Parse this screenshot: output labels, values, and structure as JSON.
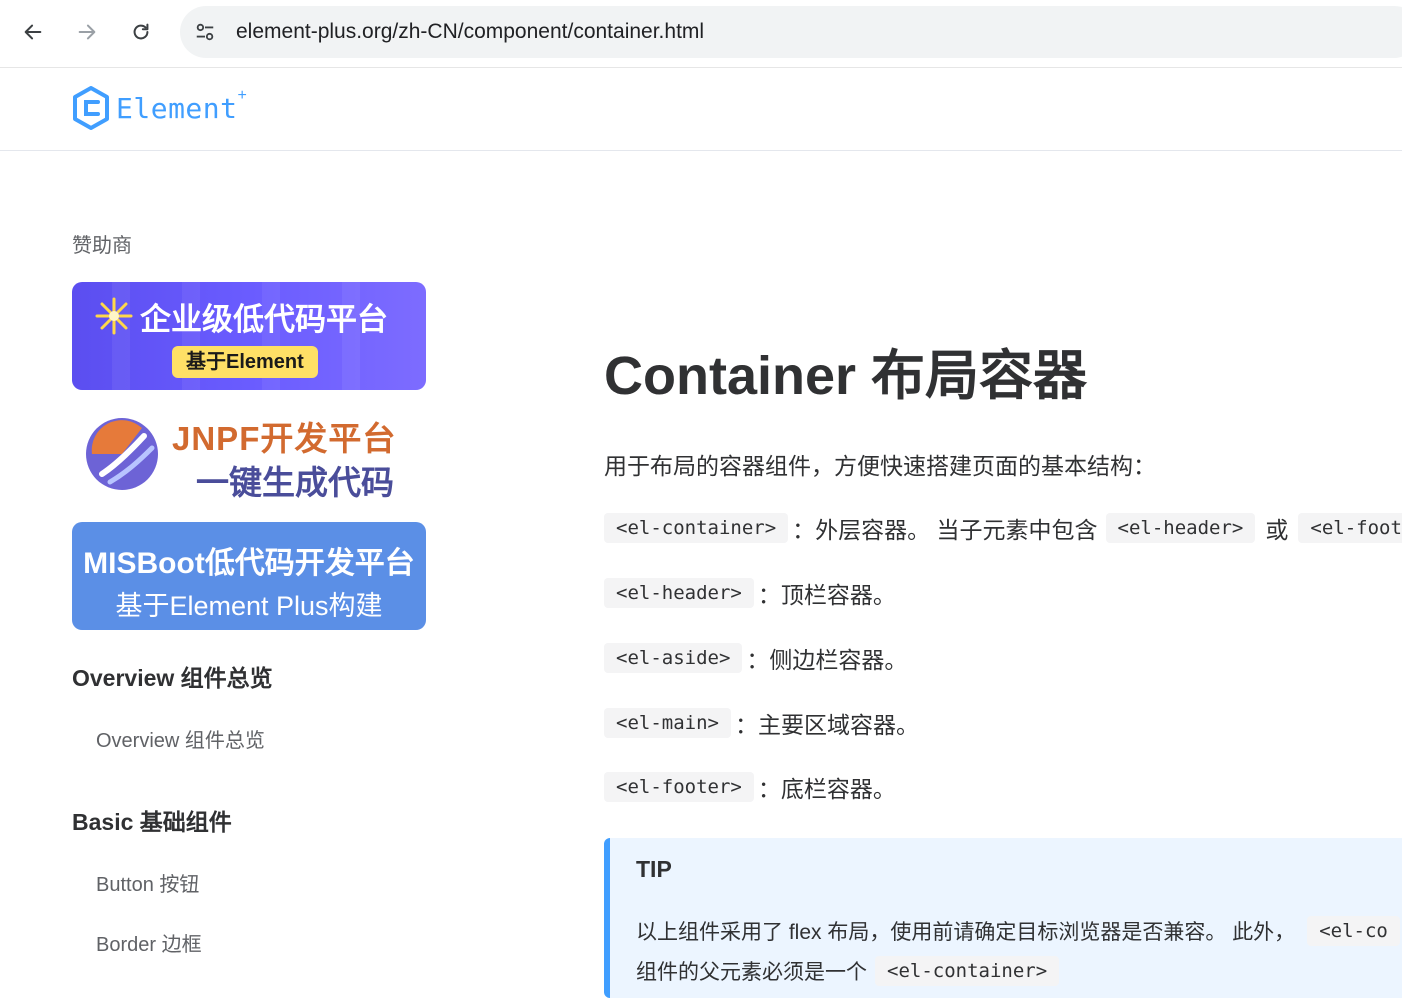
{
  "browser": {
    "url": "element-plus.org/zh-CN/component/container.html"
  },
  "site": {
    "logo_text": "Element",
    "logo_sup": "+"
  },
  "sidebar": {
    "sponsor_title": "赞助商",
    "banner1": {
      "title": "企业级低代码平台",
      "badge": "基于Element"
    },
    "banner2": {
      "line1": "JNPF开发平台",
      "line2": "一键生成代码"
    },
    "banner3": {
      "line1": "MISBoot低代码开发平台",
      "line2": "基于Element Plus构建"
    },
    "groups": [
      {
        "title": "Overview 组件总览",
        "items": [
          "Overview 组件总览"
        ]
      },
      {
        "title": "Basic 基础组件",
        "items": [
          "Button 按钮",
          "Border 边框"
        ]
      }
    ]
  },
  "main": {
    "title": "Container 布局容器",
    "intro": "用于布局的容器组件，方便快速搭建页面的基本结构：",
    "rows": [
      {
        "code": "<el-container>",
        "text": "：外层容器。 当子元素中包含",
        "code2": "<el-header>",
        "text2": "或",
        "code3": "<el-foot"
      },
      {
        "code": "<el-header>",
        "text": "：顶栏容器。"
      },
      {
        "code": "<el-aside>",
        "text": "：侧边栏容器。"
      },
      {
        "code": "<el-main>",
        "text": "：主要区域容器。"
      },
      {
        "code": "<el-footer>",
        "text": "：底栏容器。"
      }
    ],
    "tip": {
      "title": "TIP",
      "line1": "以上组件采用了 flex 布局，使用前请确定目标浏览器是否兼容。 此外，",
      "line1_code": "<el-co",
      "line2": "组件的父元素必须是一个",
      "line2_code": "<el-container>"
    }
  }
}
